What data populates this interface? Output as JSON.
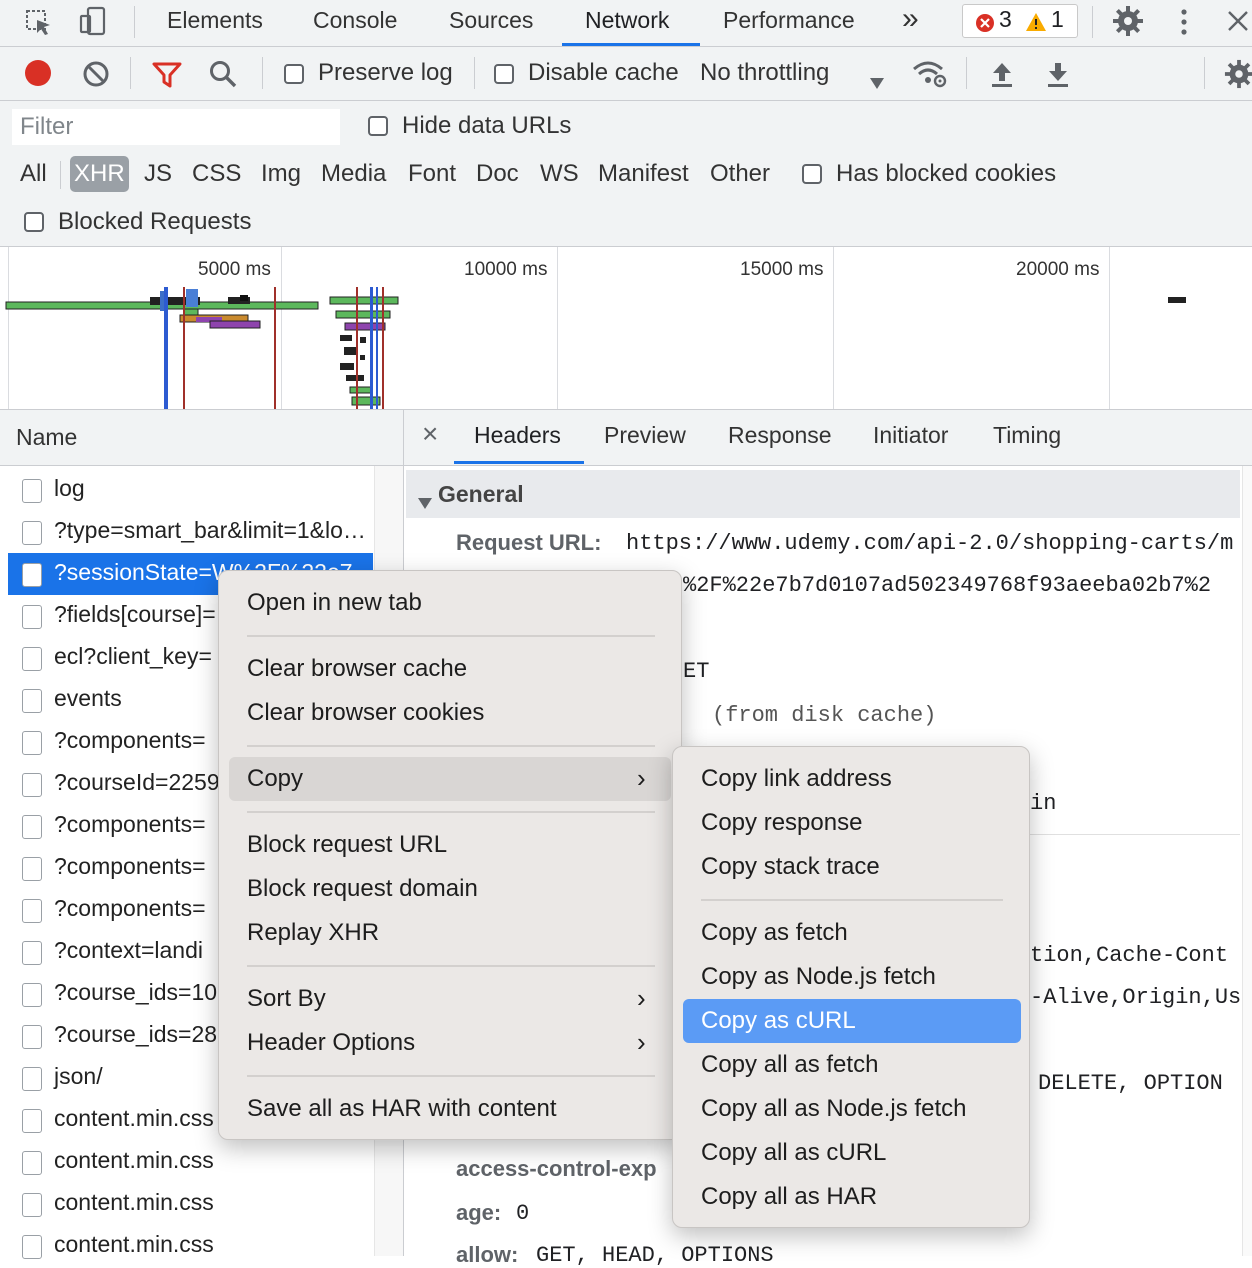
{
  "colors": {
    "accent": "#1a73e8",
    "selection": "#5b9bf5",
    "record": "#d93025",
    "filter_icon": "#d93025",
    "warn": "#f9ab00"
  },
  "top_tabs": {
    "tabs": [
      "Elements",
      "Console",
      "Sources",
      "Network",
      "Performance"
    ],
    "active": "Network",
    "more": "»",
    "error_count": "3",
    "warning_count": "1"
  },
  "toolbar": {
    "preserve_log": "Preserve log",
    "disable_cache": "Disable cache",
    "throttling": "No throttling"
  },
  "filter": {
    "placeholder": "Filter",
    "hide_data_urls": "Hide data URLs",
    "types": [
      "All",
      "XHR",
      "JS",
      "CSS",
      "Img",
      "Media",
      "Font",
      "Doc",
      "WS",
      "Manifest",
      "Other"
    ],
    "selected_type": "XHR",
    "has_blocked_cookies": "Has blocked cookies",
    "blocked_requests": "Blocked Requests"
  },
  "overview": {
    "ticks": [
      "5000 ms",
      "10000 ms",
      "15000 ms",
      "20000 ms"
    ]
  },
  "requests": {
    "header": "Name",
    "rows": [
      "log",
      "?type=smart_bar&limit=1&lo…",
      "?sessionState=W%2F%22e7",
      "?fields[course]=",
      "ecl?client_key=",
      "events",
      "?components=",
      "?courseId=2259",
      "?components=",
      "?components=",
      "?components=",
      "?context=landi",
      "?course_ids=10",
      "?course_ids=28",
      "json/",
      "content.min.css",
      "content.min.css",
      "content.min.css",
      "content.min.css"
    ],
    "selected_index": 2
  },
  "details": {
    "tabs": [
      "Headers",
      "Preview",
      "Response",
      "Initiator",
      "Timing"
    ],
    "active_tab": "Headers",
    "close": "×",
    "section": "General",
    "request_url_label": "Request URL:",
    "request_url_value": "https://www.udemy.com/api-2.0/shopping-carts/m",
    "url_cont": "%2F%22e7b7d0107ad502349768f93aeeba02b7%2",
    "method_frag": "ET",
    "status_frag": "(from disk cache)",
    "policy_frag": "in",
    "allow_headers_frag": "tion,Cache-Cont",
    "allow_headers_frag2": "-Alive,Origin,Us",
    "methods_frag": "DELETE, OPTION",
    "acl_expose_label": "access-control-exp",
    "age_label": "age:",
    "age_value": "0",
    "allow_label": "allow:",
    "allow_value": "GET, HEAD, OPTIONS"
  },
  "context_menu": {
    "items": [
      {
        "label": "Open in new tab"
      },
      {
        "label": "Clear browser cache"
      },
      {
        "label": "Clear browser cookies"
      },
      {
        "label": "Copy",
        "submenu": true
      },
      {
        "label": "Block request URL"
      },
      {
        "label": "Block request domain"
      },
      {
        "label": "Replay XHR"
      },
      {
        "label": "Sort By",
        "submenu": true
      },
      {
        "label": "Header Options",
        "submenu": true
      },
      {
        "label": "Save all as HAR with content"
      }
    ],
    "submenu": [
      "Copy link address",
      "Copy response",
      "Copy stack trace",
      "Copy as fetch",
      "Copy as Node.js fetch",
      "Copy as cURL",
      "Copy all as fetch",
      "Copy all as Node.js fetch",
      "Copy all as cURL",
      "Copy all as HAR"
    ],
    "submenu_highlighted": "Copy as cURL"
  }
}
